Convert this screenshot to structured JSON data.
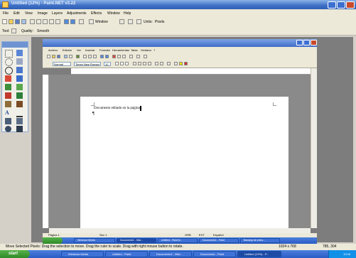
{
  "paintnet": {
    "title": "Untitled (12%) - Paint.NET v3.22",
    "menu": [
      "File",
      "Edit",
      "View",
      "Image",
      "Layers",
      "Adjustments",
      "Effects",
      "Window",
      "Help"
    ],
    "toolbar": {
      "window_label": "Window",
      "units_label": "Units:",
      "units_value": "Pixels",
      "tool_label": "Tool:",
      "quality_label": "Quality:",
      "quality_value": "Smooth"
    },
    "status": {
      "message": "Move Selected Pixels: Drag the selection to move. Drag the ruler to scale. Drag with right mouse button to rotate.",
      "image_size": "1024 x 768",
      "cursor_pos": "785, 304"
    }
  },
  "word": {
    "menu": [
      "Archivo",
      "Edición",
      "Ver",
      "Insertar",
      "Formato",
      "Herramientas",
      "Tabla",
      "Ventana",
      "?"
    ],
    "style_value": "Normal",
    "font_value": "Times New Roman",
    "size_value": "12",
    "document_text": "Documento editado en la página",
    "status": {
      "page": "Página 1",
      "section": "Sec 1",
      "lang": "Español",
      "rec": "GRB",
      "ext": "EXT"
    },
    "taskbar_buttons": [
      "Windows Media",
      "Documento1 - Micr...",
      "Untitled - Paint.N...",
      "Documento1 - Paint",
      "Bandeja de entra..."
    ]
  },
  "taskbar": {
    "start_label": "start",
    "buttons": [
      "Windows Media",
      "Untitled - Paint",
      "Documento1 - Micr...",
      "Documento - Paint",
      "Untitled (12%) - P..."
    ],
    "clock": "10:06"
  },
  "colors": {
    "titlebar_blue": "#3d6fc4",
    "taskbar_blue": "#2a5bc4",
    "start_green": "#2f8a28",
    "canvas_grey": "#7d7d7d"
  }
}
